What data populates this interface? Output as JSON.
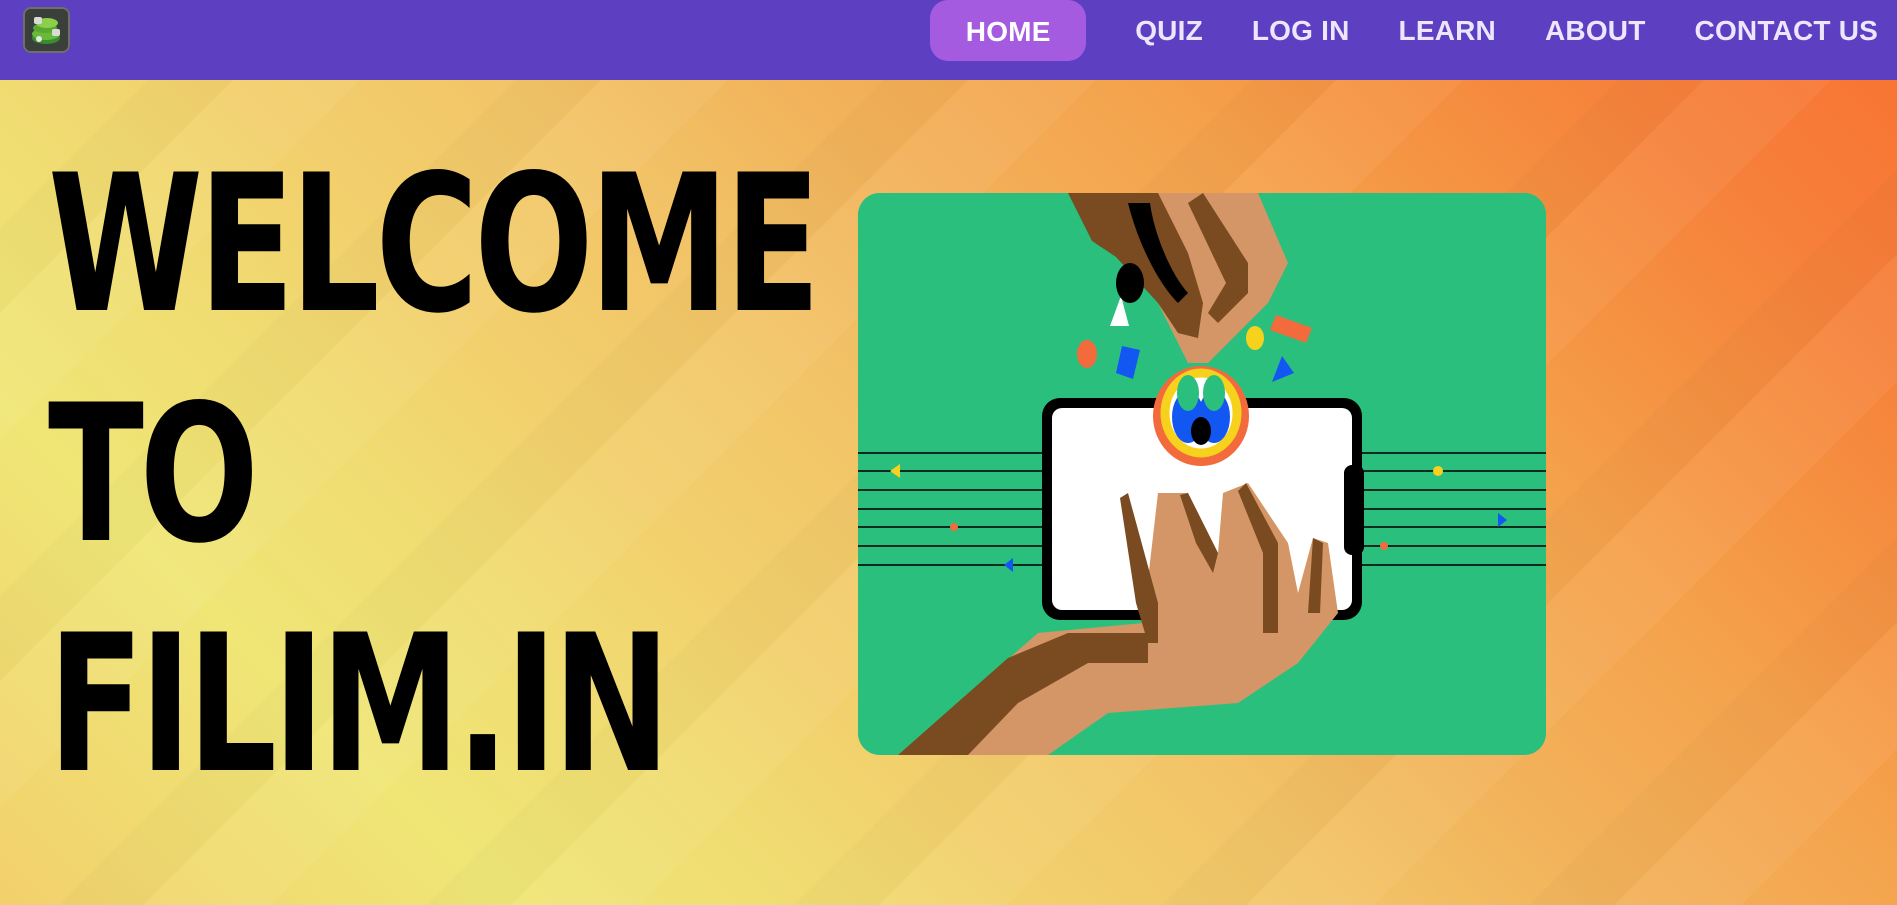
{
  "navbar": {
    "logo_icon": "green-stack-logo-icon",
    "items": [
      {
        "label": "HOME",
        "active": true
      },
      {
        "label": "QUIZ"
      },
      {
        "label": "LOG IN"
      },
      {
        "label": "LEARN"
      },
      {
        "label": "ABOUT"
      },
      {
        "label": "CONTACT US"
      }
    ]
  },
  "hero": {
    "lines": [
      "WELCOME",
      "TO",
      "FILIM.IN"
    ],
    "illustration_icon": "hands-holding-phone-illustration"
  },
  "colors": {
    "navbar_bg": "#5d3fc1",
    "nav_active_bg": "#a45be0",
    "card_bg": "#2bbf7e",
    "text": "#000000"
  }
}
